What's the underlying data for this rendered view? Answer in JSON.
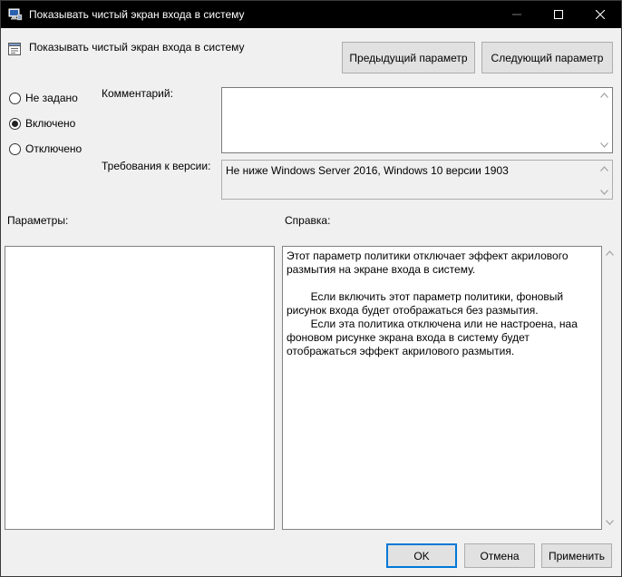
{
  "window": {
    "title": "Показывать чистый экран входа в систему",
    "icon": "policy-editor-icon",
    "controls": [
      "minimize-icon",
      "maximize-icon",
      "close-icon"
    ]
  },
  "policy": {
    "title": "Показывать чистый экран входа в систему",
    "icon": "policy-setting-icon"
  },
  "nav": {
    "prev_label": "Предыдущий параметр",
    "next_label": "Следующий параметр"
  },
  "state": {
    "options": [
      "Не задано",
      "Включено",
      "Отключено"
    ],
    "selected": "Включено"
  },
  "comment": {
    "label": "Комментарий:",
    "value": ""
  },
  "supported": {
    "label": "Требования к версии:",
    "value": "Не ниже Windows Server 2016, Windows 10 версии 1903"
  },
  "options_panel": {
    "label": "Параметры:"
  },
  "help_panel": {
    "label": "Справка:",
    "text": "Этот параметр политики отключает эффект акрилового\nразмытия на экране входа в систему.\n\n        Если включить этот параметр политики, фоновый\nрисунок входа будет отображаться без размытия.\n        Если эта политика отключена или не настроена, наа\nфоновом рисунке экрана входа в систему будет\nотображаться эффект акрилового размытия."
  },
  "footer": {
    "ok_label": "OK",
    "cancel_label": "Отмена",
    "apply_label": "Применить"
  }
}
